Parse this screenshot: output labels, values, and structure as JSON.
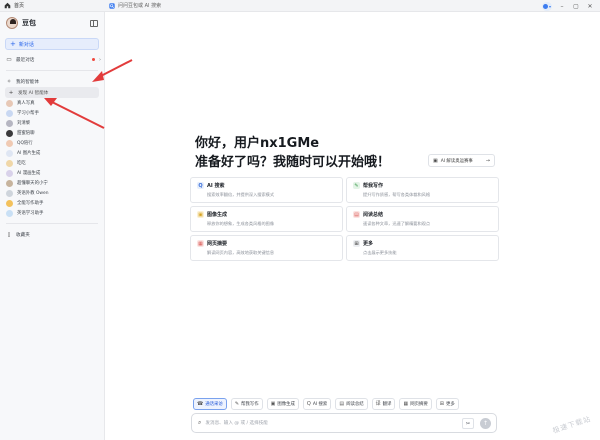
{
  "titlebar": {
    "home_label": "首页",
    "address_placeholder": "问问豆包或 AI 搜索"
  },
  "sidebar": {
    "brand": "豆包",
    "new_chat": "新对话",
    "recent": "最近对话",
    "my_agents": "我的智能体",
    "discover": "发现 AI 智能体",
    "agents": [
      {
        "name": "真人写真",
        "color": "#e7c8b6"
      },
      {
        "name": "学习小帮手",
        "color": "#c9d8f2"
      },
      {
        "name": "刘清黎",
        "color": "#b6b6c2"
      },
      {
        "name": "甜蜜陪聊",
        "color": "#3b3a3d"
      },
      {
        "name": "QQ陪行",
        "color": "#f0cab3"
      },
      {
        "name": "AI 图片生成",
        "color": "#dfe6f3"
      },
      {
        "name": "吃吃",
        "color": "#f0d7a8"
      },
      {
        "name": "AI 漫画生成",
        "color": "#d9d2ea"
      },
      {
        "name": "超懂聊天的小宁",
        "color": "#c7b49e"
      },
      {
        "name": "英语外教 Owen",
        "color": "#cfd5dc"
      },
      {
        "name": "全能写作助手",
        "color": "#f3c15c"
      },
      {
        "name": "英语学习助手",
        "color": "#c9e0f5"
      }
    ],
    "favorites": "收藏夹"
  },
  "main": {
    "greeting_line1": "你好，用户nx1GMe",
    "greeting_line2": "准备好了吗？我随时可以开始哦！",
    "summary_button": "AI 解读奥运赛事",
    "cards": [
      {
        "title": "AI 搜索",
        "desc": "搜索效率翻倍，并提供深入搜索模式",
        "icon": "search-icon",
        "icon_char": "Q",
        "fg": "#3b6fd9",
        "bg": "#e6eefc"
      },
      {
        "title": "帮我写作",
        "desc": "提升写作质感，帮写各类体裁和风格",
        "icon": "pen-icon",
        "icon_char": "✎",
        "fg": "#3a9a4b",
        "bg": "#e3f3e6"
      },
      {
        "title": "图像生成",
        "desc": "释放你的想象，生成各类风格的图像",
        "icon": "image-icon",
        "icon_char": "▣",
        "fg": "#d6a21e",
        "bg": "#fbf0d3"
      },
      {
        "title": "阅读总结",
        "desc": "速读各种文章，迅速了解精要和观点",
        "icon": "document-icon",
        "icon_char": "▤",
        "fg": "#d9534f",
        "bg": "#fbe3e2"
      },
      {
        "title": "网页摘要",
        "desc": "解读网页内容，高效地获取关键信息",
        "icon": "web-summary-icon",
        "icon_char": "▦",
        "fg": "#d9534f",
        "bg": "#fbe3e2"
      },
      {
        "title": "更多",
        "desc": "点击展示更多技能",
        "icon": "more-icon",
        "icon_char": "⊞",
        "fg": "#555",
        "bg": "#eceef1"
      }
    ]
  },
  "toolbar": {
    "items": [
      {
        "label": "通话采访",
        "icon": "phone-icon",
        "glyph": "☎",
        "active": true
      },
      {
        "label": "帮我写作",
        "icon": "pen-icon",
        "glyph": "✎",
        "active": false
      },
      {
        "label": "图像生成",
        "icon": "image-icon",
        "glyph": "▣",
        "active": false
      },
      {
        "label": "AI 搜索",
        "icon": "search-icon",
        "glyph": "Q",
        "active": false
      },
      {
        "label": "阅读总结",
        "icon": "document-icon",
        "glyph": "▤",
        "active": false
      },
      {
        "label": "翻译",
        "icon": "translate-icon",
        "glyph": "译",
        "active": false
      },
      {
        "label": "网页摘要",
        "icon": "web-summary-icon",
        "glyph": "▦",
        "active": false
      },
      {
        "label": "更多",
        "icon": "more-icon",
        "glyph": "⊞",
        "active": false
      }
    ]
  },
  "composer": {
    "placeholder": "发消息、输入 @ 或 / 选择技能"
  },
  "watermark": "极速下载站"
}
